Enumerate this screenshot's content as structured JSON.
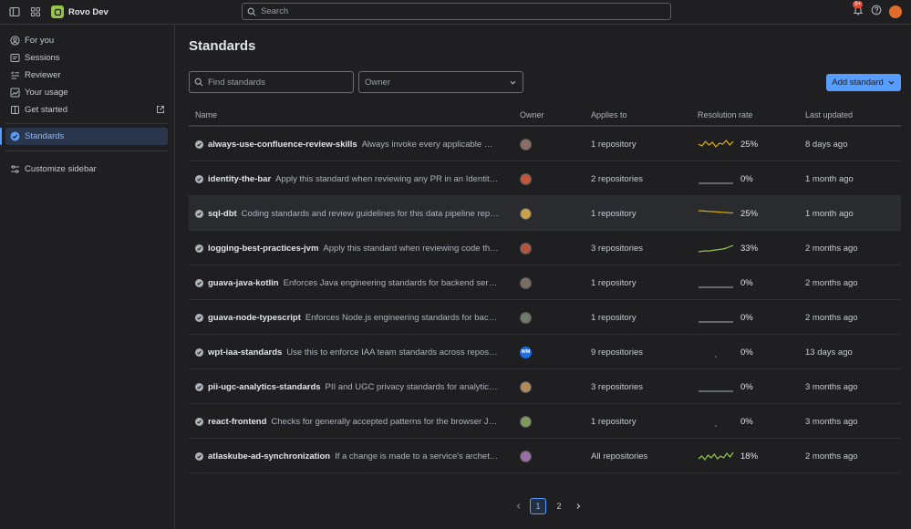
{
  "app": {
    "title": "Rovo Dev"
  },
  "search": {
    "placeholder": "Search"
  },
  "notifications": {
    "badge": "9+"
  },
  "sidebar": {
    "items": [
      {
        "label": "For you",
        "icon": "user-circle-icon"
      },
      {
        "label": "Sessions",
        "icon": "sessions-icon"
      },
      {
        "label": "Reviewer",
        "icon": "reviewer-icon"
      },
      {
        "label": "Your usage",
        "icon": "chart-line-icon"
      },
      {
        "label": "Get started",
        "icon": "book-icon"
      }
    ],
    "active_item": "Standards",
    "customize": "Customize sidebar"
  },
  "page": {
    "title": "Standards",
    "find_placeholder": "Find standards",
    "owner_placeholder": "Owner",
    "add_button": "Add standard"
  },
  "table": {
    "columns": [
      "Name",
      "Owner",
      "Applies to",
      "Resolution rate",
      "Last updated"
    ],
    "rows": [
      {
        "name": "always-use-confluence-review-skills",
        "desc": "Always invoke every applicable Confl...",
        "applies": "1 repository",
        "rate": "25%",
        "updated": "8 days ago",
        "spark": [
          0.5,
          0.3,
          0.8,
          0.4,
          0.7,
          0.2,
          0.6,
          0.5,
          0.9,
          0.4,
          0.8
        ],
        "spark_color": "#e2b203"
      },
      {
        "name": "identity-the-bar",
        "desc": "Apply this standard when reviewing any PR in an Identity-o...",
        "applies": "2 repositories",
        "rate": "0%",
        "updated": "1 month ago",
        "spark": [
          0,
          0,
          0,
          0,
          0,
          0,
          0,
          0,
          0,
          0,
          0
        ],
        "spark_color": "#8c9099"
      },
      {
        "name": "sql-dbt",
        "desc": "Coding standards and review guidelines for this data pipeline reposit...",
        "applies": "1 repository",
        "rate": "25%",
        "updated": "1 month ago",
        "spark": [
          0.8,
          0.78,
          0.75,
          0.72,
          0.7,
          0.68,
          0.65,
          0.62,
          0.6,
          0.57,
          0.55
        ],
        "spark_color": "#e2b203"
      },
      {
        "name": "logging-best-practices-jvm",
        "desc": "Apply this standard when reviewing code that a...",
        "applies": "3 repositories",
        "rate": "33%",
        "updated": "2 months ago",
        "spark": [
          0.1,
          0.15,
          0.2,
          0.18,
          0.25,
          0.3,
          0.35,
          0.4,
          0.5,
          0.65,
          0.8
        ],
        "spark_color": "#94c748"
      },
      {
        "name": "guava-java-kotlin",
        "desc": "Enforces Java engineering standards for backend service...",
        "applies": "1 repository",
        "rate": "0%",
        "updated": "2 months ago",
        "spark": [
          0,
          0,
          0,
          0,
          0,
          0,
          0,
          0,
          0,
          0,
          0
        ],
        "spark_color": "#8c9099"
      },
      {
        "name": "guava-node-typescript",
        "desc": "Enforces Node.js engineering standards for backen...",
        "applies": "1 repository",
        "rate": "0%",
        "updated": "2 months ago",
        "spark": [
          0,
          0,
          0,
          0,
          0,
          0,
          0,
          0,
          0,
          0,
          0
        ],
        "spark_color": "#8c9099"
      },
      {
        "name": "wpt-iaa-standards",
        "desc": "Use this to enforce IAA team standards across repositori...",
        "applies": "9 repositories",
        "rate": "0%",
        "updated": "13 days ago",
        "spark": [
          0
        ],
        "spark_color": "#8c9099"
      },
      {
        "name": "pii-ugc-analytics-standards",
        "desc": "PII and UGC privacy standards for analytics ev...",
        "applies": "3 repositories",
        "rate": "0%",
        "updated": "3 months ago",
        "spark": [
          0,
          0,
          0,
          0,
          0,
          0,
          0,
          0,
          0,
          0,
          0
        ],
        "spark_color": "#8c9099"
      },
      {
        "name": "react-frontend",
        "desc": "Checks for generally accepted patterns for the browser Java...",
        "applies": "1 repository",
        "rate": "0%",
        "updated": "3 months ago",
        "spark": [
          0
        ],
        "spark_color": "#8c9099"
      },
      {
        "name": "atlaskube-ad-synchronization",
        "desc": "If a change is made to a service's archetype ...",
        "applies": "All repositories",
        "rate": "18%",
        "updated": "2 months ago",
        "spark": [
          0.2,
          0.5,
          0.1,
          0.6,
          0.3,
          0.7,
          0.2,
          0.5,
          0.3,
          0.8,
          0.4,
          0.9
        ],
        "spark_color": "#94c748"
      }
    ]
  },
  "pagination": {
    "pages": [
      "1",
      "2"
    ],
    "current": "1"
  }
}
